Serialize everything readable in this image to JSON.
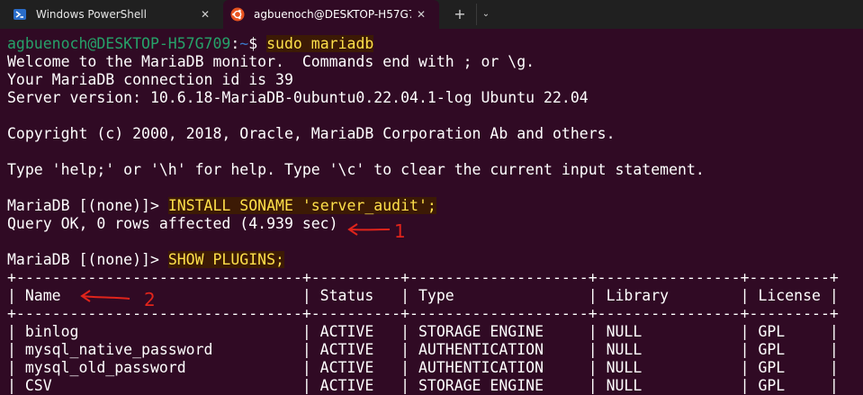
{
  "tabs": [
    {
      "label": "Windows PowerShell",
      "icon": "powershell-icon",
      "active": false
    },
    {
      "label": "agbuenoch@DESKTOP-H57G7",
      "icon": "ubuntu-icon",
      "active": true
    }
  ],
  "tab_close_glyph": "✕",
  "newtab_glyph": "+",
  "dropdown_glyph": "⌄",
  "prompt": {
    "user": "agbuenoch@DESKTOP-H57G709",
    "colon": ":",
    "path": "~",
    "dollar": "$ ",
    "command": "sudo mariadb"
  },
  "welcome": [
    "Welcome to the MariaDB monitor.  Commands end with ; or \\g.",
    "Your MariaDB connection id is 39",
    "Server version: 10.6.18-MariaDB-0ubuntu0.22.04.1-log Ubuntu 22.04",
    "",
    "Copyright (c) 2000, 2018, Oracle, MariaDB Corporation Ab and others.",
    "",
    "Type 'help;' or '\\h' for help. Type '\\c' to clear the current input statement.",
    ""
  ],
  "install": {
    "prompt": "MariaDB [(none)]> ",
    "command": "INSTALL SONAME 'server_audit';"
  },
  "query_ok": "Query OK, 0 rows affected (4.939 sec)",
  "show": {
    "prompt": "MariaDB [(none)]> ",
    "command": "SHOW PLUGINS;"
  },
  "table": {
    "separator": "+--------------------------------+----------+--------------------+----------------+---------+",
    "header": "| Name                           | Status   | Type               | Library        | License |",
    "rows": [
      "| binlog                         | ACTIVE   | STORAGE ENGINE     | NULL           | GPL     |",
      "| mysql_native_password          | ACTIVE   | AUTHENTICATION     | NULL           | GPL     |",
      "| mysql_old_password             | ACTIVE   | AUTHENTICATION     | NULL           | GPL     |",
      "| CSV                            | ACTIVE   | STORAGE ENGINE     | NULL           | GPL     |"
    ]
  },
  "annotations": {
    "one": "1",
    "two": "2",
    "color": "#e0241b"
  },
  "colors": {
    "background": "#300a24",
    "titlebar": "#202020",
    "user": "#26a269",
    "path": "#3b78c9",
    "highlight": "#ffe04a"
  }
}
